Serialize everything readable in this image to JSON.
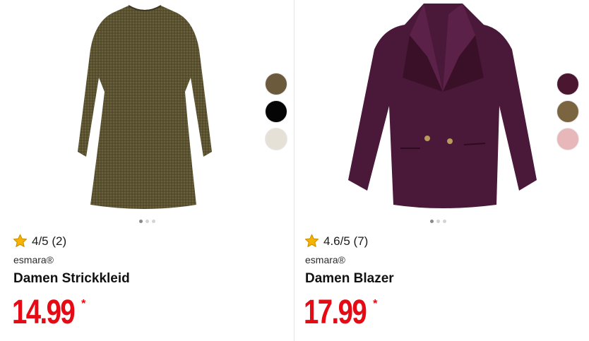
{
  "products": [
    {
      "rating": "4/5 (2)",
      "brand": "esmara®",
      "title": "Damen Strickkleid",
      "price": "14.99",
      "price_note": "*",
      "image_icon": "knit-dress-image",
      "swatches": [
        "#6b5a3c",
        "#050505",
        "#e5e1d6"
      ],
      "active_dot": 0,
      "dot_count": 3
    },
    {
      "rating": "4.6/5 (7)",
      "brand": "esmara®",
      "title": "Damen Blazer",
      "price": "17.99",
      "price_note": "*",
      "image_icon": "blazer-image",
      "swatches": [
        "#4a1630",
        "#7a6540",
        "#e8b7b9"
      ],
      "active_dot": 0,
      "dot_count": 3
    }
  ],
  "colors": {
    "price": "#e60a14",
    "star_fill": "#f6b300",
    "star_stroke": "#c98f00",
    "dress": "#5b5232",
    "blazer": "#4a1838"
  }
}
